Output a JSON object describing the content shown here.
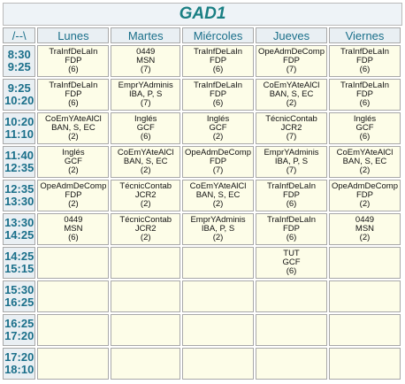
{
  "title": "GAD1",
  "corner": "/--\\",
  "days": [
    "Lunes",
    "Martes",
    "Miércoles",
    "Jueves",
    "Viernes"
  ],
  "rows": [
    {
      "start": "8:30",
      "end": "9:25",
      "cells": [
        {
          "s": "TraInfDeLaIn",
          "t": "FDP",
          "g": "(6)"
        },
        {
          "s": "0449",
          "t": "MSN",
          "g": "(7)"
        },
        {
          "s": "TraInfDeLaIn",
          "t": "FDP",
          "g": "(6)"
        },
        {
          "s": "OpeAdmDeComp",
          "t": "FDP",
          "g": "(7)"
        },
        {
          "s": "TraInfDeLaIn",
          "t": "FDP",
          "g": "(6)"
        }
      ]
    },
    {
      "start": "9:25",
      "end": "10:20",
      "cells": [
        {
          "s": "TraInfDeLaIn",
          "t": "FDP",
          "g": "(6)"
        },
        {
          "s": "EmprYAdminis",
          "t": "IBA, P, S",
          "g": "(7)"
        },
        {
          "s": "TraInfDeLaIn",
          "t": "FDP",
          "g": "(6)"
        },
        {
          "s": "CoEmYAteAlCl",
          "t": "BAN, S, EC",
          "g": "(2)"
        },
        {
          "s": "TraInfDeLaIn",
          "t": "FDP",
          "g": "(6)"
        }
      ]
    },
    {
      "start": "10:20",
      "end": "11:10",
      "cells": [
        {
          "s": "CoEmYAteAlCl",
          "t": "BAN, S, EC",
          "g": "(2)"
        },
        {
          "s": "Inglés",
          "t": "GCF",
          "g": "(6)"
        },
        {
          "s": "Inglés",
          "t": "GCF",
          "g": "(2)"
        },
        {
          "s": "TécnicContab",
          "t": "JCR2",
          "g": "(7)"
        },
        {
          "s": "Inglés",
          "t": "GCF",
          "g": "(6)"
        }
      ]
    },
    {
      "start": "11:40",
      "end": "12:35",
      "cells": [
        {
          "s": "Inglés",
          "t": "GCF",
          "g": "(2)"
        },
        {
          "s": "CoEmYAteAlCl",
          "t": "BAN, S, EC",
          "g": "(2)"
        },
        {
          "s": "OpeAdmDeComp",
          "t": "FDP",
          "g": "(7)"
        },
        {
          "s": "EmprYAdminis",
          "t": "IBA, P, S",
          "g": "(7)"
        },
        {
          "s": "CoEmYAteAlCl",
          "t": "BAN, S, EC",
          "g": "(2)"
        }
      ]
    },
    {
      "start": "12:35",
      "end": "13:30",
      "cells": [
        {
          "s": "OpeAdmDeComp",
          "t": "FDP",
          "g": "(2)"
        },
        {
          "s": "TécnicContab",
          "t": "JCR2",
          "g": "(2)"
        },
        {
          "s": "CoEmYAteAlCl",
          "t": "BAN, S, EC",
          "g": "(2)"
        },
        {
          "s": "TraInfDeLaIn",
          "t": "FDP",
          "g": "(6)"
        },
        {
          "s": "OpeAdmDeComp",
          "t": "FDP",
          "g": "(2)"
        }
      ]
    },
    {
      "start": "13:30",
      "end": "14:25",
      "cells": [
        {
          "s": "0449",
          "t": "MSN",
          "g": "(6)"
        },
        {
          "s": "TécnicContab",
          "t": "JCR2",
          "g": "(2)"
        },
        {
          "s": "EmprYAdminis",
          "t": "IBA, P, S",
          "g": "(2)"
        },
        {
          "s": "TraInfDeLaIn",
          "t": "FDP",
          "g": "(6)"
        },
        {
          "s": "0449",
          "t": "MSN",
          "g": "(2)"
        }
      ]
    },
    {
      "start": "14:25",
      "end": "15:15",
      "cells": [
        null,
        null,
        null,
        {
          "s": "TUT",
          "t": "GCF",
          "g": "(6)"
        },
        null
      ]
    },
    {
      "start": "15:30",
      "end": "16:25",
      "cells": [
        null,
        null,
        null,
        null,
        null
      ]
    },
    {
      "start": "16:25",
      "end": "17:20",
      "cells": [
        null,
        null,
        null,
        null,
        null
      ]
    },
    {
      "start": "17:20",
      "end": "18:10",
      "cells": [
        null,
        null,
        null,
        null,
        null
      ]
    }
  ]
}
